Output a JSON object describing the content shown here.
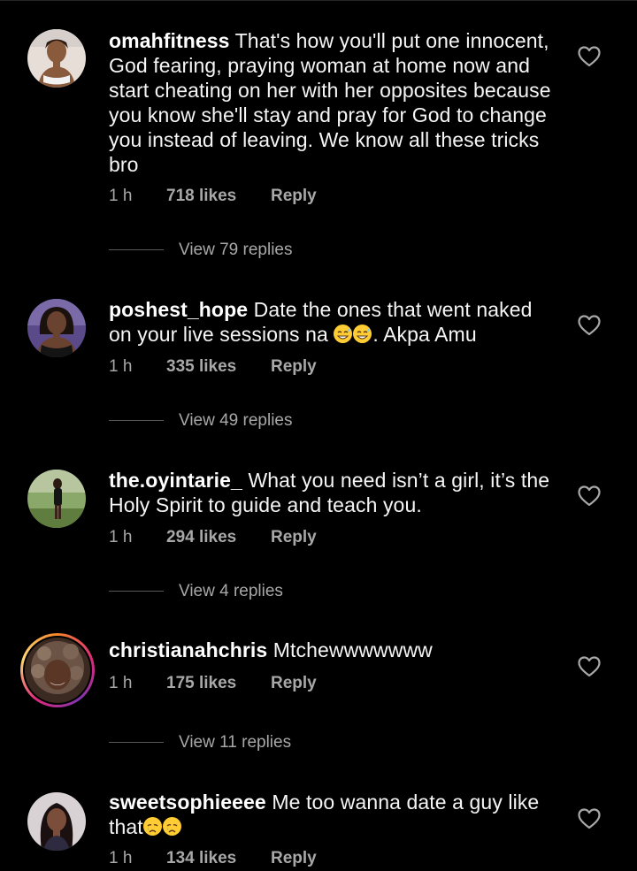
{
  "comments": [
    {
      "username": "omahfitness",
      "text": "That's how you'll put one innocent, God fearing, praying woman at home now and start cheating on her with her opposites because you know she'll stay and pray for God to change you instead of leaving. We know all these tricks bro",
      "text_after_emoji": "",
      "time": "1 h",
      "likes": "718 likes",
      "reply": "Reply",
      "view_replies": "View 79 replies"
    },
    {
      "username": "poshest_hope",
      "text": "Date the ones that went naked on your live sessions na ",
      "text_after_emoji": ". Akpa Amu",
      "emoji": "grinning-sweat-face",
      "time": "1 h",
      "likes": "335 likes",
      "reply": "Reply",
      "view_replies": "View 49 replies"
    },
    {
      "username": "the.oyintarie_",
      "text": "What you need isn’t a girl, it’s the Holy Spirit to guide and teach you.",
      "text_after_emoji": "",
      "time": "1 h",
      "likes": "294 likes",
      "reply": "Reply",
      "view_replies": "View 4 replies"
    },
    {
      "username": "christianahchris",
      "text": "Mtchewwwwwww",
      "text_after_emoji": "",
      "time": "1 h",
      "likes": "175 likes",
      "reply": "Reply",
      "view_replies": "View 11 replies"
    },
    {
      "username": "sweetsophieeee",
      "text": "Me too wanna date a guy like that",
      "text_after_emoji": "",
      "emoji": "crying-face",
      "time": "1 h",
      "likes": "134 likes",
      "reply": "Reply"
    }
  ],
  "colors": {
    "background": "#000000",
    "text": "#f5f5f5",
    "secondary_text": "#a8a8a8",
    "emoji": "#ffcc33"
  },
  "icons": {
    "like": "heart-outline-icon"
  }
}
